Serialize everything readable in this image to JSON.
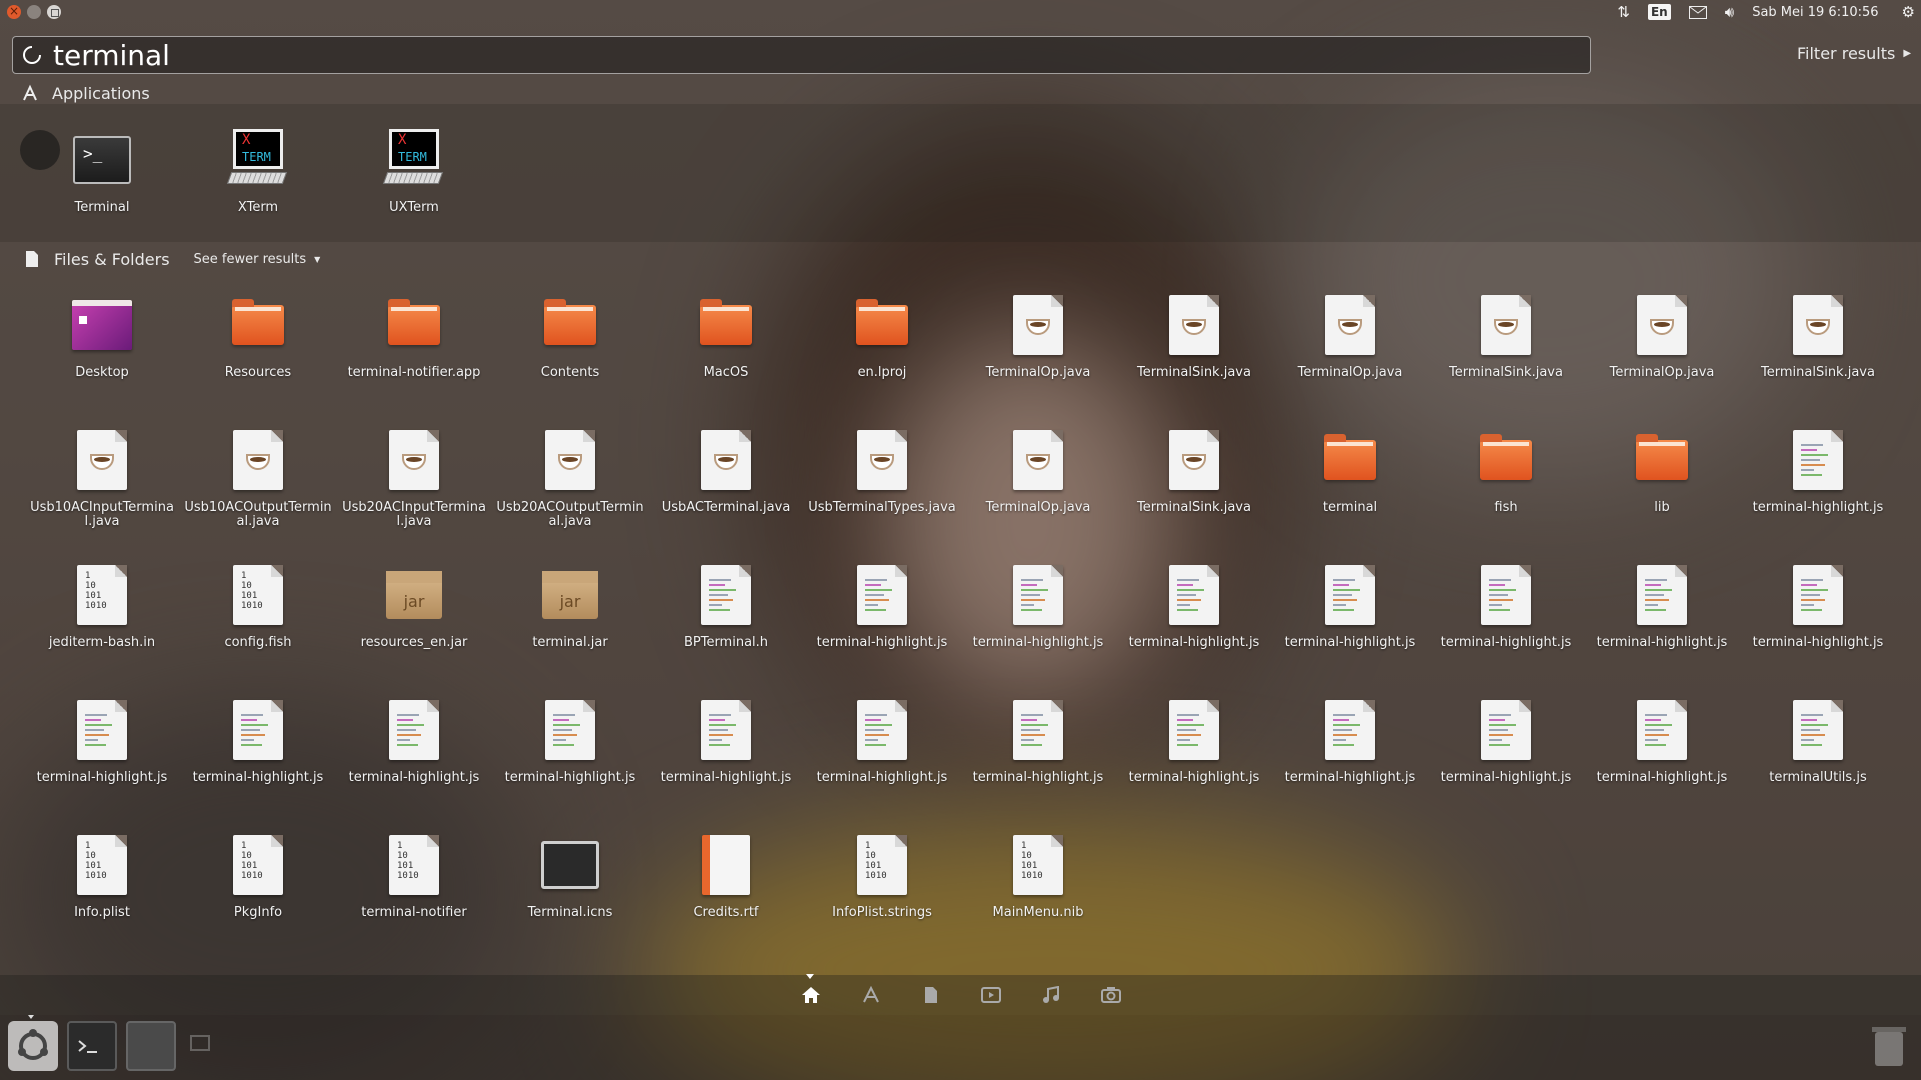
{
  "top_panel": {
    "keyboard_layout": "En",
    "clock": "Sab Mei 19  6:10:56"
  },
  "search": {
    "query": "terminal",
    "filter_label": "Filter results"
  },
  "applications": {
    "header": "Applications",
    "items": [
      {
        "label": "Terminal",
        "icon": "terminal-app-icon"
      },
      {
        "label": "XTerm",
        "icon": "xterm-app-icon"
      },
      {
        "label": "UXTerm",
        "icon": "uxterm-app-icon"
      }
    ]
  },
  "files": {
    "header": "Files & Folders",
    "see_fewer": "See fewer results",
    "rows": [
      [
        {
          "label": "Desktop",
          "icon": "desktop"
        },
        {
          "label": "Resources",
          "icon": "folder"
        },
        {
          "label": "terminal-notifier.app",
          "icon": "folder"
        },
        {
          "label": "Contents",
          "icon": "folder"
        },
        {
          "label": "MacOS",
          "icon": "folder"
        },
        {
          "label": "en.lproj",
          "icon": "folder"
        },
        {
          "label": "TerminalOp.java",
          "icon": "java"
        },
        {
          "label": "TerminalSink.java",
          "icon": "java"
        },
        {
          "label": "TerminalOp.java",
          "icon": "java"
        },
        {
          "label": "TerminalSink.java",
          "icon": "java"
        },
        {
          "label": "TerminalOp.java",
          "icon": "java"
        },
        {
          "label": "TerminalSink.java",
          "icon": "java"
        }
      ],
      [
        {
          "label": "Usb10ACInputTerminal.java",
          "icon": "java"
        },
        {
          "label": "Usb10ACOutputTerminal.java",
          "icon": "java"
        },
        {
          "label": "Usb20ACInputTerminal.java",
          "icon": "java"
        },
        {
          "label": "Usb20ACOutputTerminal.java",
          "icon": "java"
        },
        {
          "label": "UsbACTerminal.java",
          "icon": "java"
        },
        {
          "label": "UsbTerminalTypes.java",
          "icon": "java"
        },
        {
          "label": "TerminalOp.java",
          "icon": "java"
        },
        {
          "label": "TerminalSink.java",
          "icon": "java"
        },
        {
          "label": "terminal",
          "icon": "folder"
        },
        {
          "label": "fish",
          "icon": "folder"
        },
        {
          "label": "lib",
          "icon": "folder"
        },
        {
          "label": "terminal-highlight.js",
          "icon": "script"
        }
      ],
      [
        {
          "label": "jediterm-bash.in",
          "icon": "binary"
        },
        {
          "label": "config.fish",
          "icon": "binary"
        },
        {
          "label": "resources_en.jar",
          "icon": "jar"
        },
        {
          "label": "terminal.jar",
          "icon": "jar"
        },
        {
          "label": "BPTerminal.h",
          "icon": "script"
        },
        {
          "label": "terminal-highlight.js",
          "icon": "script"
        },
        {
          "label": "terminal-highlight.js",
          "icon": "script"
        },
        {
          "label": "terminal-highlight.js",
          "icon": "script"
        },
        {
          "label": "terminal-highlight.js",
          "icon": "script"
        },
        {
          "label": "terminal-highlight.js",
          "icon": "script"
        },
        {
          "label": "terminal-highlight.js",
          "icon": "script"
        },
        {
          "label": "terminal-highlight.js",
          "icon": "script"
        }
      ],
      [
        {
          "label": "terminal-highlight.js",
          "icon": "script"
        },
        {
          "label": "terminal-highlight.js",
          "icon": "script"
        },
        {
          "label": "terminal-highlight.js",
          "icon": "script"
        },
        {
          "label": "terminal-highlight.js",
          "icon": "script"
        },
        {
          "label": "terminal-highlight.js",
          "icon": "script"
        },
        {
          "label": "terminal-highlight.js",
          "icon": "script"
        },
        {
          "label": "terminal-highlight.js",
          "icon": "script"
        },
        {
          "label": "terminal-highlight.js",
          "icon": "script"
        },
        {
          "label": "terminal-highlight.js",
          "icon": "script"
        },
        {
          "label": "terminal-highlight.js",
          "icon": "script"
        },
        {
          "label": "terminal-highlight.js",
          "icon": "script"
        },
        {
          "label": "terminalUtils.js",
          "icon": "script"
        }
      ],
      [
        {
          "label": "Info.plist",
          "icon": "binary"
        },
        {
          "label": "PkgInfo",
          "icon": "binary"
        },
        {
          "label": "terminal-notifier",
          "icon": "binary"
        },
        {
          "label": "Terminal.icns",
          "icon": "icns"
        },
        {
          "label": "Credits.rtf",
          "icon": "rtf"
        },
        {
          "label": "InfoPlist.strings",
          "icon": "binary"
        },
        {
          "label": "MainMenu.nib",
          "icon": "binary"
        }
      ]
    ]
  },
  "lenses": [
    {
      "name": "home-lens-icon",
      "active": true
    },
    {
      "name": "applications-lens-icon",
      "active": false
    },
    {
      "name": "files-lens-icon",
      "active": false
    },
    {
      "name": "video-lens-icon",
      "active": false
    },
    {
      "name": "music-lens-icon",
      "active": false
    },
    {
      "name": "photos-lens-icon",
      "active": false
    }
  ],
  "colors": {
    "folder_orange": "#e0531f",
    "accent_white": "#ffffff"
  }
}
